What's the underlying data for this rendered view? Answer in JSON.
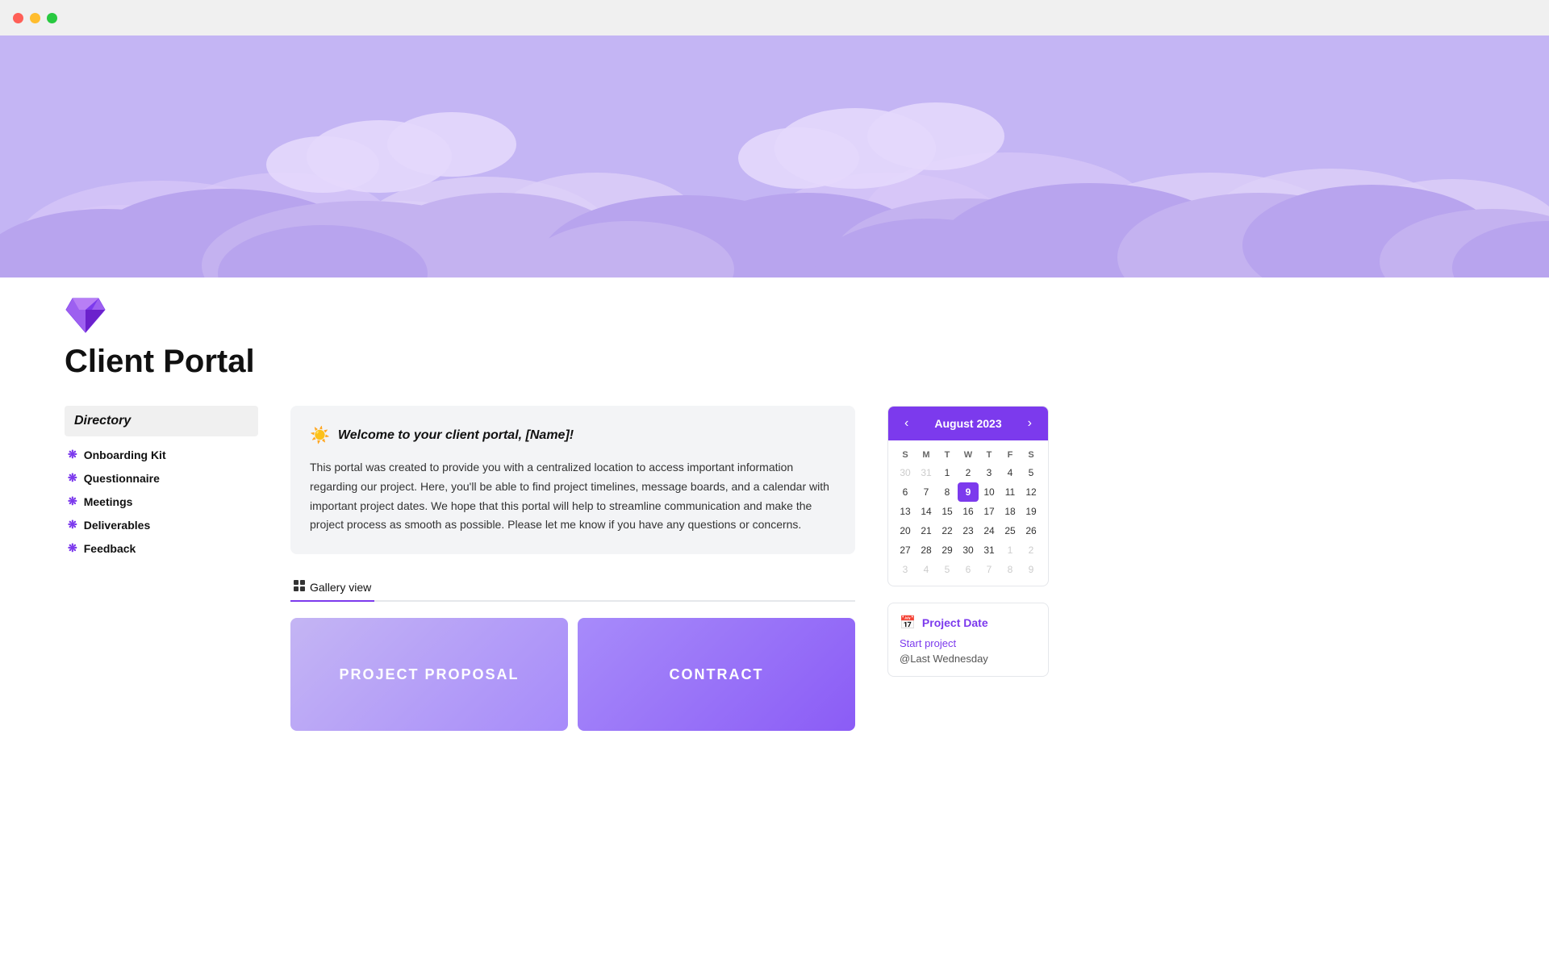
{
  "titlebar": {
    "buttons": {
      "close": "close",
      "minimize": "minimize",
      "maximize": "maximize"
    }
  },
  "hero": {
    "background_color": "#c4b5f4"
  },
  "page": {
    "icon": "💎",
    "title": "Client Portal"
  },
  "welcome": {
    "icon": "☀",
    "heading": "Welcome to your client portal, [Name]!",
    "body": "This portal was created to provide you with a centralized location to access important information regarding our project. Here, you'll be able to find project timelines, message boards, and a calendar with important project dates. We hope that this portal will help to streamline communication and make the project process as smooth as possible. Please let me know if you have any questions or concerns."
  },
  "gallery": {
    "tab_icon": "⊞",
    "tab_label": "Gallery view",
    "cards": [
      {
        "label": "PROJECT PROPOSAL",
        "style": "proposal"
      },
      {
        "label": "CONTRACT",
        "style": "contract"
      }
    ]
  },
  "directory": {
    "title": "Directory",
    "items": [
      {
        "label": "Onboarding Kit"
      },
      {
        "label": "Questionnaire"
      },
      {
        "label": "Meetings"
      },
      {
        "label": "Deliverables"
      },
      {
        "label": "Feedback"
      }
    ]
  },
  "calendar": {
    "prev_label": "‹",
    "next_label": "›",
    "month_year": "August 2023",
    "day_headers": [
      "S",
      "M",
      "T",
      "W",
      "T",
      "F",
      "S"
    ],
    "weeks": [
      [
        {
          "day": "30",
          "month": "other"
        },
        {
          "day": "31",
          "month": "other"
        },
        {
          "day": "1",
          "month": "current"
        },
        {
          "day": "2",
          "month": "current"
        },
        {
          "day": "3",
          "month": "current"
        },
        {
          "day": "4",
          "month": "current"
        },
        {
          "day": "5",
          "month": "current"
        }
      ],
      [
        {
          "day": "6",
          "month": "current"
        },
        {
          "day": "7",
          "month": "current"
        },
        {
          "day": "8",
          "month": "current"
        },
        {
          "day": "9",
          "month": "current",
          "today": true
        },
        {
          "day": "10",
          "month": "current"
        },
        {
          "day": "11",
          "month": "current"
        },
        {
          "day": "12",
          "month": "current"
        }
      ],
      [
        {
          "day": "13",
          "month": "current"
        },
        {
          "day": "14",
          "month": "current"
        },
        {
          "day": "15",
          "month": "current"
        },
        {
          "day": "16",
          "month": "current"
        },
        {
          "day": "17",
          "month": "current"
        },
        {
          "day": "18",
          "month": "current"
        },
        {
          "day": "19",
          "month": "current"
        }
      ],
      [
        {
          "day": "20",
          "month": "current"
        },
        {
          "day": "21",
          "month": "current"
        },
        {
          "day": "22",
          "month": "current"
        },
        {
          "day": "23",
          "month": "current"
        },
        {
          "day": "24",
          "month": "current"
        },
        {
          "day": "25",
          "month": "current"
        },
        {
          "day": "26",
          "month": "current"
        }
      ],
      [
        {
          "day": "27",
          "month": "current"
        },
        {
          "day": "28",
          "month": "current"
        },
        {
          "day": "29",
          "month": "current"
        },
        {
          "day": "30",
          "month": "current"
        },
        {
          "day": "31",
          "month": "current"
        },
        {
          "day": "1",
          "month": "other"
        },
        {
          "day": "2",
          "month": "other"
        }
      ],
      [
        {
          "day": "3",
          "month": "other"
        },
        {
          "day": "4",
          "month": "other"
        },
        {
          "day": "5",
          "month": "other"
        },
        {
          "day": "6",
          "month": "other"
        },
        {
          "day": "7",
          "month": "other"
        },
        {
          "day": "8",
          "month": "other"
        },
        {
          "day": "9",
          "month": "other"
        }
      ]
    ]
  },
  "project_date": {
    "icon": "📅",
    "title": "Project Date",
    "start_label": "Start project",
    "value": "@Last Wednesday"
  }
}
